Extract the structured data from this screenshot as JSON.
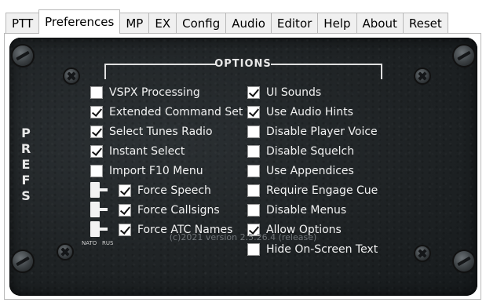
{
  "tabs": [
    {
      "label": "PTT",
      "active": false
    },
    {
      "label": "Preferences",
      "active": true
    },
    {
      "label": "MP",
      "active": false
    },
    {
      "label": "EX",
      "active": false
    },
    {
      "label": "Config",
      "active": false
    },
    {
      "label": "Audio",
      "active": false
    },
    {
      "label": "Editor",
      "active": false
    },
    {
      "label": "Help",
      "active": false
    },
    {
      "label": "About",
      "active": false
    },
    {
      "label": "Reset",
      "active": false
    }
  ],
  "panel": {
    "title": "OPTIONS",
    "side_label": "PREFS",
    "version": "(c)2021 version 2.5.26.4 (release)",
    "toggle_labels": {
      "left": "NATO",
      "right": "RUS"
    }
  },
  "left_options": [
    {
      "label": "VSPX Processing",
      "checked": false
    },
    {
      "label": "Extended Command Set",
      "checked": true
    },
    {
      "label": "Select Tunes Radio",
      "checked": true
    },
    {
      "label": "Instant Select",
      "checked": true
    },
    {
      "label": "Import F10 Menu",
      "checked": false
    }
  ],
  "sub_options": [
    {
      "label": "Force Speech",
      "checked": true
    },
    {
      "label": "Force Callsigns",
      "checked": true
    },
    {
      "label": "Force ATC Names",
      "checked": true
    }
  ],
  "right_options": [
    {
      "label": "UI Sounds",
      "checked": true
    },
    {
      "label": "Use Audio Hints",
      "checked": true
    },
    {
      "label": "Disable Player Voice",
      "checked": false
    },
    {
      "label": "Disable Squelch",
      "checked": false
    },
    {
      "label": "Use Appendices",
      "checked": false
    },
    {
      "label": "Require Engage Cue",
      "checked": false
    },
    {
      "label": "Disable Menus",
      "checked": false
    },
    {
      "label": "Allow Options",
      "checked": true
    },
    {
      "label": "Hide On-Screen Text",
      "checked": false
    }
  ]
}
